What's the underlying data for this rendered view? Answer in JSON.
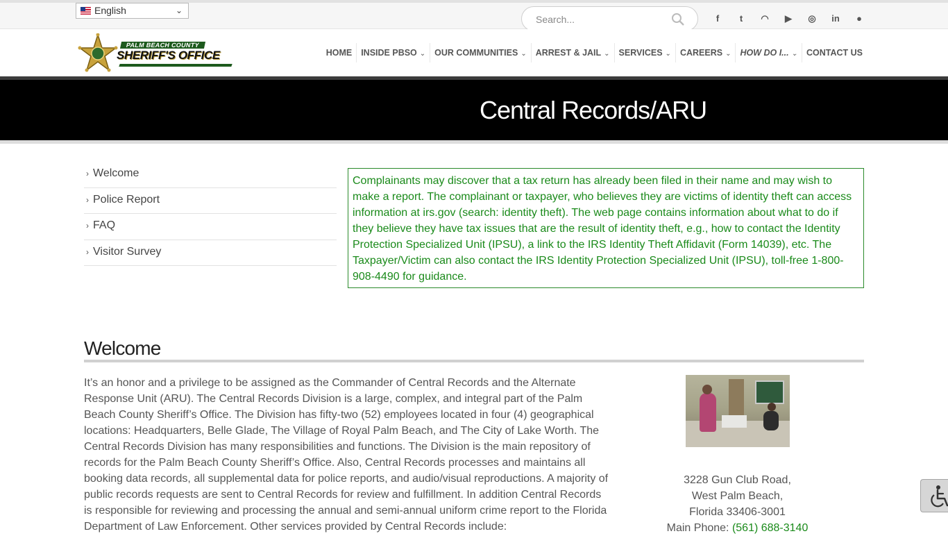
{
  "topbar": {
    "language": "English",
    "search_placeholder": "Search...",
    "social": [
      {
        "icon": "facebook-icon",
        "glyph": "f"
      },
      {
        "icon": "twitter-icon",
        "glyph": "t"
      },
      {
        "icon": "rss-icon",
        "glyph": "◠"
      },
      {
        "icon": "youtube-icon",
        "glyph": "▶"
      },
      {
        "icon": "instagram-icon",
        "glyph": "◎"
      },
      {
        "icon": "linkedin-icon",
        "glyph": "in"
      },
      {
        "icon": "reddit-icon",
        "glyph": "●"
      }
    ]
  },
  "logo": {
    "line1": "PALM BEACH COUNTY",
    "line2": "SHERIFF'S OFFICE"
  },
  "nav": [
    {
      "label": "HOME",
      "dropdown": false
    },
    {
      "label": "INSIDE PBSO",
      "dropdown": true
    },
    {
      "label": "OUR COMMUNITIES",
      "dropdown": true
    },
    {
      "label": "ARREST & JAIL",
      "dropdown": true
    },
    {
      "label": "SERVICES",
      "dropdown": true
    },
    {
      "label": "CAREERS",
      "dropdown": true
    },
    {
      "label": "HOW DO I...",
      "dropdown": true,
      "italic": true
    },
    {
      "label": "CONTACT US",
      "dropdown": false
    }
  ],
  "hero": {
    "title": "Central Records/ARU"
  },
  "side_nav": [
    "Welcome",
    "Police Report",
    "FAQ",
    "Visitor Survey"
  ],
  "notice": {
    "text": "Complainants may discover that a tax return has already been filed in their name and may wish to make a report. The complainant or taxpayer, who believes they are victims of identity theft can access information at irs.gov (search: identity theft). The web page contains information about what to do if they believe they have tax issues that are the result of identity theft, e.g., how to contact the Identity Protection Specialized Unit (IPSU), a link to the IRS Identity Theft Affidavit (Form 14039), etc. The Taxpayer/Victim can also contact the IRS Identity Protection Specialized Unit (IPSU), toll-free 1-800-908-4490 for guidance."
  },
  "welcome": {
    "title": "Welcome",
    "body": "It’s an honor and a privilege to be assigned as the Commander of Central Records and the Alternate Response Unit (ARU). The Central Records Division is a large, complex, and integral part of the Palm Beach County Sheriff’s Office. The Division has fifty-two (52) employees located in four (4) geographical locations: Headquarters, Belle Glade, The Village of Royal Palm Beach, and The City of Lake Worth. The Central Records Division has many responsibilities and functions. The Division is the main repository of records for the Palm Beach County Sheriff’s Office. Also, Central Records processes and maintains all booking data records, all supplemental data for police reports, and audio/visual reproductions. A majority of public records requests are sent to Central Records for review and fulfillment. In addition Central Records is responsible for reviewing and processing the annual and semi-annual uniform crime report to the Florida Department of Law Enforcement. Other services provided by Central Records include:"
  },
  "address": {
    "line1": "3228 Gun Club Road,",
    "line2": "West Palm Beach,",
    "line3": "Florida 33406-3001",
    "phone_label": "Main Phone:",
    "phone": "(561) 688-3140"
  },
  "colors": {
    "accent_green": "#1a8a1a",
    "hero_bg": "#000000"
  }
}
